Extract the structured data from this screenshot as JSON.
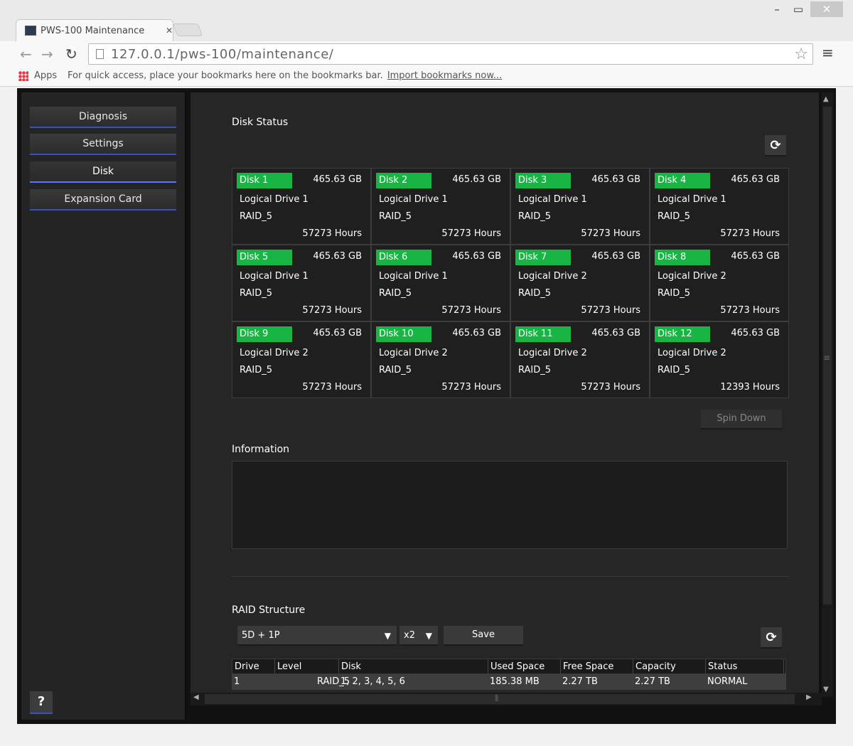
{
  "browser": {
    "tab_title": "PWS-100 Maintenance",
    "url": "127.0.0.1/pws-100/maintenance/",
    "bookmarks_apps": "Apps",
    "bookmarks_hint": "For quick access, place your bookmarks here on the bookmarks bar.",
    "bookmarks_import": "Import bookmarks now..."
  },
  "sidebar": {
    "items": [
      {
        "label": "Diagnosis"
      },
      {
        "label": "Settings"
      },
      {
        "label": "Disk"
      },
      {
        "label": "Expansion Card"
      }
    ],
    "active": "Disk",
    "help_label": "?"
  },
  "disk_status": {
    "title": "Disk Status",
    "disks": [
      {
        "name": "Disk 1",
        "size": "465.63 GB",
        "drive": "Logical Drive 1",
        "raid": "RAID_5",
        "hours": "57273 Hours"
      },
      {
        "name": "Disk 2",
        "size": "465.63 GB",
        "drive": "Logical Drive 1",
        "raid": "RAID_5",
        "hours": "57273 Hours"
      },
      {
        "name": "Disk 3",
        "size": "465.63 GB",
        "drive": "Logical Drive 1",
        "raid": "RAID_5",
        "hours": "57273 Hours"
      },
      {
        "name": "Disk 4",
        "size": "465.63 GB",
        "drive": "Logical Drive 1",
        "raid": "RAID_5",
        "hours": "57273 Hours"
      },
      {
        "name": "Disk 5",
        "size": "465.63 GB",
        "drive": "Logical Drive 1",
        "raid": "RAID_5",
        "hours": "57273 Hours"
      },
      {
        "name": "Disk 6",
        "size": "465.63 GB",
        "drive": "Logical Drive 1",
        "raid": "RAID_5",
        "hours": "57273 Hours"
      },
      {
        "name": "Disk 7",
        "size": "465.63 GB",
        "drive": "Logical Drive 2",
        "raid": "RAID_5",
        "hours": "57273 Hours"
      },
      {
        "name": "Disk 8",
        "size": "465.63 GB",
        "drive": "Logical Drive 2",
        "raid": "RAID_5",
        "hours": "57273 Hours"
      },
      {
        "name": "Disk 9",
        "size": "465.63 GB",
        "drive": "Logical Drive 2",
        "raid": "RAID_5",
        "hours": "57273 Hours"
      },
      {
        "name": "Disk 10",
        "size": "465.63 GB",
        "drive": "Logical Drive 2",
        "raid": "RAID_5",
        "hours": "57273 Hours"
      },
      {
        "name": "Disk 11",
        "size": "465.63 GB",
        "drive": "Logical Drive 2",
        "raid": "RAID_5",
        "hours": "57273 Hours"
      },
      {
        "name": "Disk 12",
        "size": "465.63 GB",
        "drive": "Logical Drive 2",
        "raid": "RAID_5",
        "hours": "12393 Hours"
      }
    ],
    "spin_down_label": "Spin Down",
    "status_color": "#18b545"
  },
  "information": {
    "title": "Information",
    "content": ""
  },
  "raid_structure": {
    "title": "RAID Structure",
    "layout_value": "5D + 1P",
    "multiplier_value": "x2",
    "save_label": "Save",
    "columns": [
      "Drive",
      "Level",
      "Disk",
      "Used Space",
      "Free Space",
      "Capacity",
      "Status"
    ],
    "rows": [
      [
        "1",
        "RAID_5",
        "1, 2, 3, 4, 5, 6",
        "185.38 MB",
        "2.27 TB",
        "2.27 TB",
        "NORMAL"
      ]
    ]
  }
}
